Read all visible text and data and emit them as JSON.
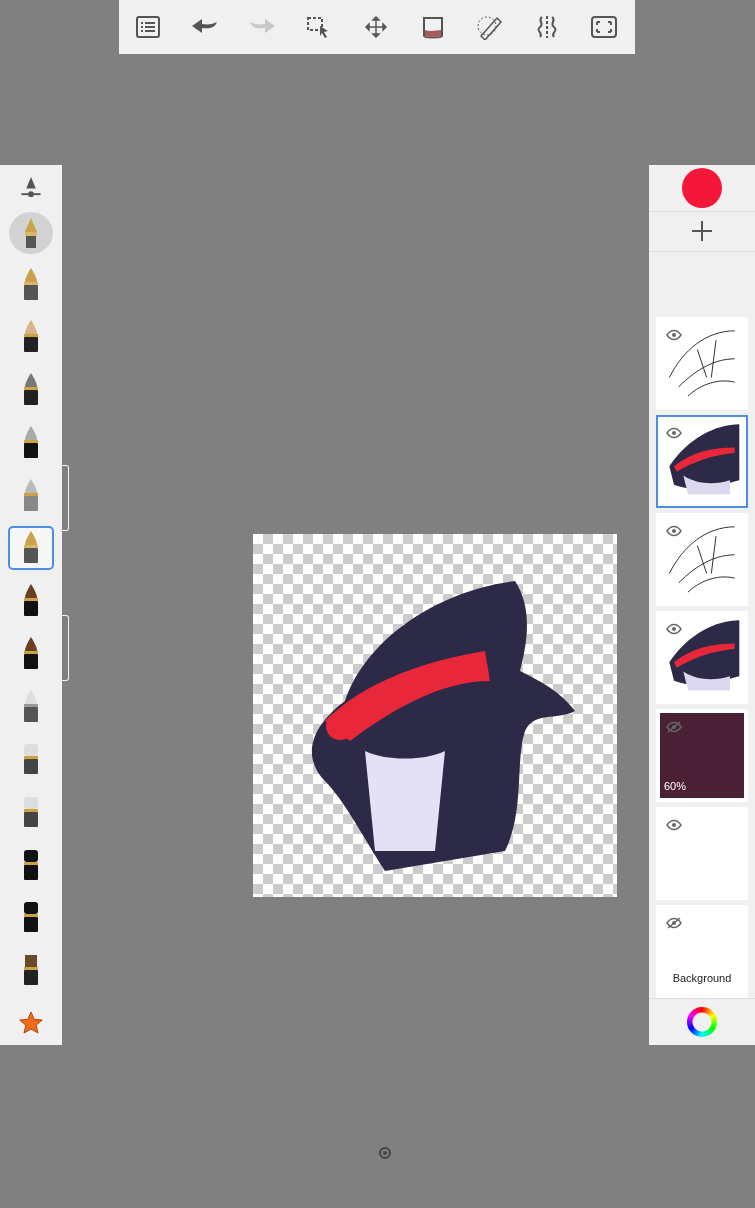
{
  "toolbar": [
    {
      "kind": "menu",
      "disabled": false
    },
    {
      "kind": "undo",
      "disabled": false
    },
    {
      "kind": "redo",
      "disabled": true
    },
    {
      "kind": "select",
      "disabled": false
    },
    {
      "kind": "move",
      "disabled": false
    },
    {
      "kind": "fill",
      "disabled": false
    },
    {
      "kind": "ruler",
      "disabled": false
    },
    {
      "kind": "symmetry",
      "disabled": false
    },
    {
      "kind": "fullscreen",
      "disabled": false
    }
  ],
  "brushes": [
    {
      "kind": "nib",
      "selected": false
    },
    {
      "kind": "pencil",
      "selected": false
    },
    {
      "kind": "marker",
      "selected": false
    },
    {
      "kind": "technical",
      "selected": false
    },
    {
      "kind": "ballpoint",
      "selected": false
    },
    {
      "kind": "nib",
      "selected": true
    },
    {
      "kind": "brush",
      "selected": false
    },
    {
      "kind": "brush",
      "selected": false
    },
    {
      "kind": "airbrush",
      "selected": false
    },
    {
      "kind": "eraser",
      "selected": false
    },
    {
      "kind": "eraser",
      "selected": false
    },
    {
      "kind": "block",
      "selected": false
    },
    {
      "kind": "block",
      "selected": false
    },
    {
      "kind": "flat",
      "selected": false
    },
    {
      "kind": "star",
      "selected": false
    }
  ],
  "color": {
    "color": "#f5173a"
  },
  "layers": [
    {
      "visible": true,
      "selected": false,
      "kind": "lineart"
    },
    {
      "visible": true,
      "selected": true,
      "kind": "color"
    },
    {
      "visible": true,
      "selected": false,
      "kind": "lineart"
    },
    {
      "visible": true,
      "selected": false,
      "kind": "color"
    },
    {
      "visible": false,
      "selected": false,
      "kind": "photo",
      "opacity": "60%"
    },
    {
      "visible": true,
      "selected": false,
      "kind": "empty"
    },
    {
      "visible": false,
      "selected": false,
      "kind": "empty",
      "name": "Background"
    }
  ]
}
